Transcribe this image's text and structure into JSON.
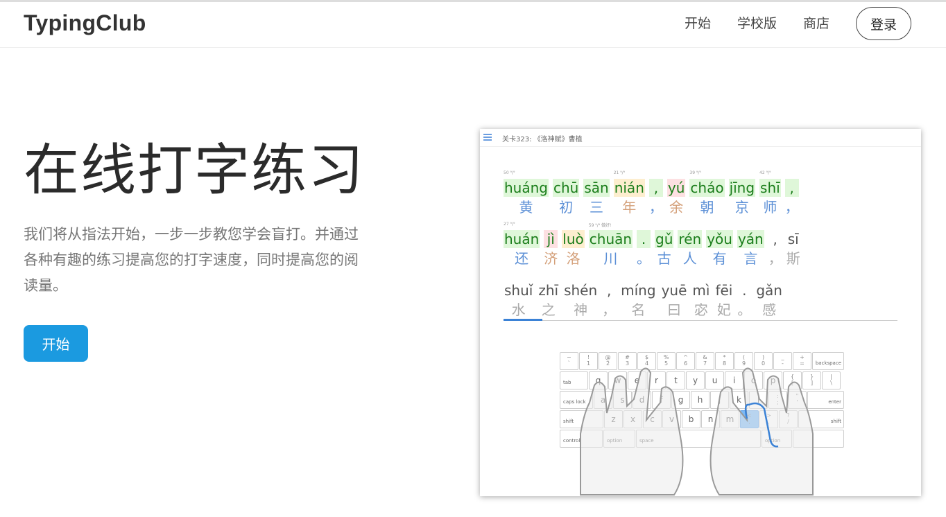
{
  "header": {
    "logo": "TypingClub",
    "nav": [
      "开始",
      "学校版",
      "商店"
    ],
    "login": "登录"
  },
  "hero": {
    "title": "在线打字练习",
    "description": "我们将从指法开始，一步一步教您学会盲打。并通过各种有趣的练习提高您的打字速度，同时提高您的阅读量。",
    "start_button": "开始"
  },
  "demo": {
    "lesson_title": "关卡323: 《洛神赋》曹植",
    "line1": [
      {
        "py": "huáng",
        "hz": "黄",
        "state": "done",
        "sup": "50 ⁹/⁹"
      },
      {
        "py": "chū",
        "hz": "初",
        "state": "done",
        "sup": ""
      },
      {
        "py": "sān",
        "hz": "三",
        "state": "done",
        "sup": ""
      },
      {
        "py": "nián",
        "hz": "年",
        "state": "warn",
        "sup": "21 ⁹/⁹"
      },
      {
        "py": ",",
        "hz": "，",
        "state": "done",
        "sup": ""
      },
      {
        "py": "yú",
        "hz": "余",
        "state": "err",
        "sup": ""
      },
      {
        "py": "cháo",
        "hz": "朝",
        "state": "done",
        "sup": "39 ⁹/⁹"
      },
      {
        "py": "jīng",
        "hz": "京",
        "state": "done",
        "sup": ""
      },
      {
        "py": "shī",
        "hz": "师",
        "state": "done",
        "sup": "42 ⁹/⁹"
      },
      {
        "py": ",",
        "hz": "，",
        "state": "done",
        "sup": ""
      }
    ],
    "line2": [
      {
        "py": "huán",
        "hz": "还",
        "state": "done",
        "sup": "27 ⁹/⁹"
      },
      {
        "py": "jì",
        "hz": "济",
        "state": "err",
        "sup": ""
      },
      {
        "py": "luò",
        "hz": "洛",
        "state": "warn",
        "sup": ""
      },
      {
        "py": "chuān",
        "hz": "川",
        "state": "done",
        "sup": "59 ⁹/⁹ 做好!"
      },
      {
        "py": ".",
        "hz": "。",
        "state": "done",
        "sup": ""
      },
      {
        "py": "gǔ",
        "hz": "古",
        "state": "done",
        "sup": ""
      },
      {
        "py": "rén",
        "hz": "人",
        "state": "done",
        "sup": ""
      },
      {
        "py": "yǒu",
        "hz": "有",
        "state": "done",
        "sup": ""
      },
      {
        "py": "yán",
        "hz": "言",
        "state": "done",
        "sup": ""
      },
      {
        "py": ",",
        "hz": "，",
        "state": "pend",
        "sup": ""
      },
      {
        "py": "sī",
        "hz": "斯",
        "state": "pend",
        "sup": ""
      }
    ],
    "line3": [
      {
        "py": "shuǐ",
        "hz": "水",
        "state": "pend",
        "sup": ""
      },
      {
        "py": "zhī",
        "hz": "之",
        "state": "pend",
        "sup": ""
      },
      {
        "py": "shén",
        "hz": "神",
        "state": "pend",
        "sup": ""
      },
      {
        "py": ",",
        "hz": "，",
        "state": "pend",
        "sup": ""
      },
      {
        "py": "míng",
        "hz": "名",
        "state": "pend",
        "sup": ""
      },
      {
        "py": "yuē",
        "hz": "曰",
        "state": "pend",
        "sup": ""
      },
      {
        "py": "mì",
        "hz": "宓",
        "state": "pend",
        "sup": ""
      },
      {
        "py": "fēi",
        "hz": "妃",
        "state": "pend",
        "sup": ""
      },
      {
        "py": ".",
        "hz": "。",
        "state": "pend",
        "sup": ""
      },
      {
        "py": "gǎn",
        "hz": "感",
        "state": "pend",
        "sup": ""
      }
    ],
    "keyboard": {
      "row1": [
        [
          "~",
          "`"
        ],
        [
          "!",
          "1"
        ],
        [
          "@",
          "2"
        ],
        [
          "#",
          "3"
        ],
        [
          "$",
          "4"
        ],
        [
          "%",
          "5"
        ],
        [
          "^",
          "6"
        ],
        [
          "&",
          "7"
        ],
        [
          "*",
          "8"
        ],
        [
          "(",
          "9"
        ],
        [
          ")",
          "0"
        ],
        [
          "_",
          "-"
        ],
        [
          "+",
          "="
        ]
      ],
      "backspace": "backspace",
      "tab": "tab",
      "row2": [
        "q",
        "w",
        "e",
        "r",
        "t",
        "y",
        "u",
        "i",
        "o",
        "p"
      ],
      "row2_sym": [
        [
          "{",
          "["
        ],
        [
          "}",
          "]"
        ],
        [
          "|",
          "\\"
        ]
      ],
      "caps": "caps lock",
      "row3": [
        "a",
        "s",
        "d",
        "f",
        "g",
        "h",
        "j",
        "k",
        "l"
      ],
      "row3_sym": [
        [
          ":",
          ";"
        ],
        [
          "\"",
          "'"
        ]
      ],
      "enter": "enter",
      "shift": "shift",
      "row4": [
        "z",
        "x",
        "c",
        "v",
        "b",
        "n",
        "m"
      ],
      "row4_sym": [
        [
          "<",
          ","
        ],
        [
          ">",
          "."
        ],
        [
          "?",
          "/"
        ]
      ],
      "shift_r": "shift",
      "control": "control",
      "option": "option",
      "space": "space",
      "option_r": "option",
      "highlight": "<"
    }
  }
}
